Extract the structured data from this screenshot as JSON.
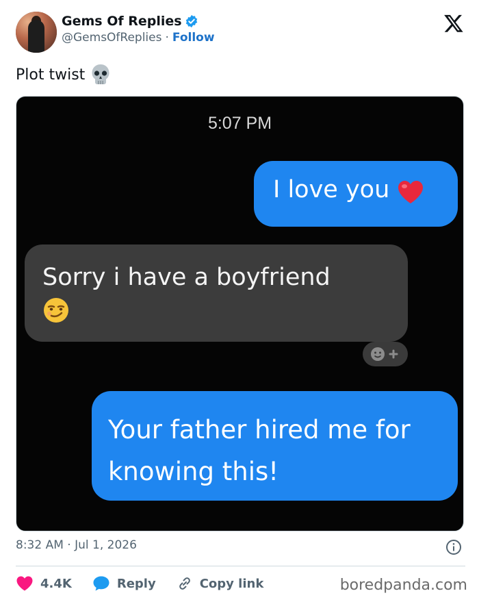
{
  "tweet": {
    "author_name": "Gems Of Replies",
    "author_handle": "@GemsOfReplies",
    "separator": "·",
    "follow_label": "Follow",
    "text": "Plot twist",
    "timestamp": "8:32 AM · Jul 1, 2026"
  },
  "media": {
    "time": "5:07 PM",
    "messages": [
      {
        "from": "me",
        "text": "I love you"
      },
      {
        "from": "them",
        "text": "Sorry i have a boyfriend"
      },
      {
        "from": "me",
        "text": "Your father hired me for knowing this!"
      }
    ]
  },
  "actions": {
    "likes": "4.4K",
    "reply_label": "Reply",
    "copy_label": "Copy link"
  },
  "watermark": "boredpanda.com",
  "colors": {
    "accent": "#1d9bf0",
    "like": "#f91880",
    "sent_bubble": "#1f86f0",
    "received_bubble": "#3c3c3c"
  },
  "icons": [
    "verified-badge-icon",
    "x-logo-icon",
    "skull-emoji-icon",
    "heart-emoji-icon",
    "smirk-emoji-icon",
    "add-reaction-icon",
    "info-icon",
    "like-heart-icon",
    "reply-bubble-icon",
    "link-icon"
  ]
}
